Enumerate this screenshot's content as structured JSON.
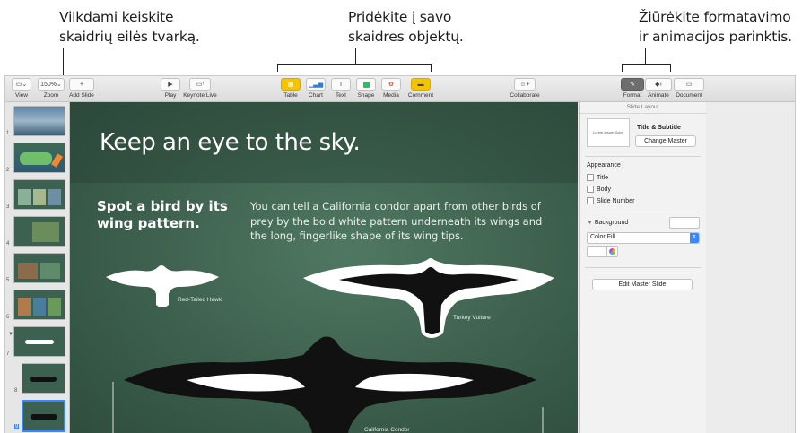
{
  "callouts": {
    "left": "Vilkdami keiskite skaidrių eilės tvarką.",
    "center": "Pridėkite į savo skaidres objektų.",
    "right": "Žiūrėkite formatavimo ir animacijos parinktis."
  },
  "toolbar": {
    "view": "View",
    "zoom_value": "150%",
    "zoom": "Zoom",
    "add_slide": "Add Slide",
    "play": "Play",
    "keynote_live": "Keynote Live",
    "table": "Table",
    "chart": "Chart",
    "text": "Text",
    "shape": "Shape",
    "media": "Media",
    "comment": "Comment",
    "collaborate": "Collaborate",
    "format": "Format",
    "animate": "Animate",
    "document": "Document"
  },
  "navigator": {
    "numbers": [
      "1",
      "2",
      "3",
      "4",
      "5",
      "6",
      "7",
      "8",
      "9"
    ]
  },
  "slide": {
    "title": "Keep an eye to the sky.",
    "subtitle": "Spot a bird by its wing pattern.",
    "body": "You can tell a California condor apart from other birds of prey by the bold white pattern underneath its wings and the long, fingerlike shape of its wing tips.",
    "cap_hawk": "Red-Tailed Hawk",
    "cap_vulture": "Turkey Vulture",
    "cap_condor": "California Condor"
  },
  "inspector": {
    "header": "Slide Layout",
    "thumb_text": "Lorem Ipsum Dolor",
    "master_name": "Title & Subtitle",
    "change_master": "Change Master",
    "appearance": "Appearance",
    "title_opt": "Title",
    "body_opt": "Body",
    "slide_number_opt": "Slide Number",
    "background": "Background",
    "fill_type": "Color Fill",
    "edit_master": "Edit Master Slide"
  },
  "colors": {
    "accent": "#f5c400",
    "selection": "#3a86ff",
    "slide_bg": "#3b5d4b"
  }
}
